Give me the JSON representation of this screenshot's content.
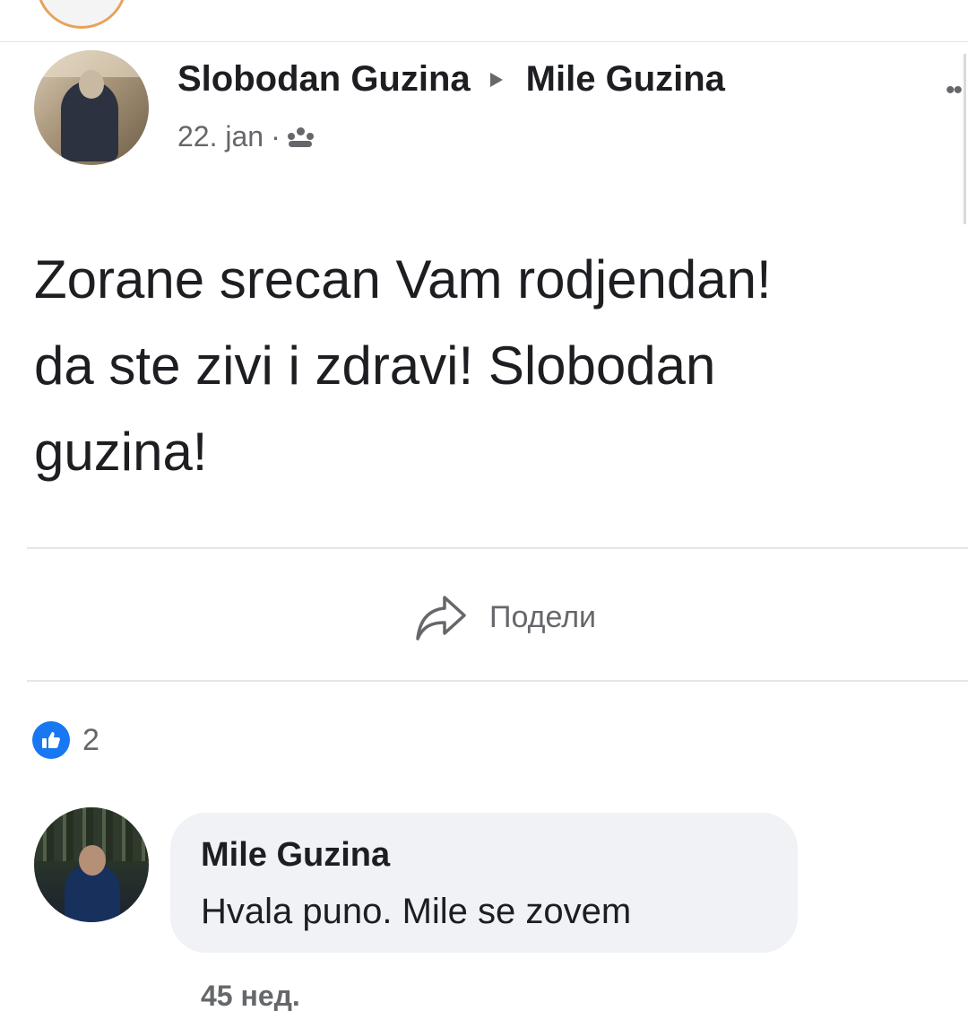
{
  "post": {
    "author": "Slobodan Guzina",
    "target": "Mile Guzina",
    "date": "22. jan",
    "separator": "·",
    "audience_icon": "group-icon",
    "body": "Zorane srecan Vam rodjendan!\nda ste zivi i zdravi! Slobodan\nguzina!"
  },
  "actions": {
    "share_label": "Подели",
    "share_icon": "share-arrow-icon"
  },
  "reactions": {
    "icon": "like-icon",
    "count": "2"
  },
  "comment": {
    "author": "Mile Guzina",
    "text": "Hvala puno. Mile se zovem",
    "time": "45 нед."
  },
  "colors": {
    "like_blue": "#1877f2",
    "secondary_text": "#65676b",
    "bubble_bg": "#f0f2f5"
  }
}
